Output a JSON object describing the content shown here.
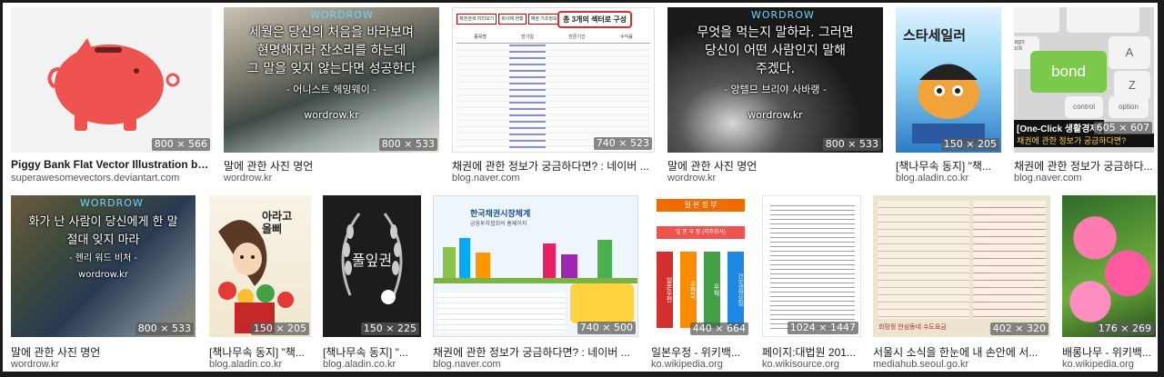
{
  "results": [
    {
      "title": "Piggy Bank Flat Vector Illustration by sup...",
      "domain": "superawesomevectors.deviantart.com",
      "dims": "800 × 566",
      "bold": true
    },
    {
      "title": "말에 관한 사진 명언",
      "domain": "wordrow.kr",
      "dims": "800 × 533",
      "bold": false,
      "overlay": [
        "세월은 당신의 처음을 바라보며",
        "현명해지라 잔소리를 하는데",
        "그 말을 잊지 않는다면 성공한다"
      ],
      "author": "- 어니스트 헤밍웨이 -",
      "brand": "wordrow.kr",
      "badge": "WORDROW"
    },
    {
      "title": "채권에 관한 정보가 궁금하다면? : 네이버 ...",
      "domain": "blog.naver.com",
      "dims": "740 × 523",
      "bold": false,
      "callout": "총 3개의 섹터로 구성",
      "tabs": [
        "채권검색 미리보기",
        "회사채 현황",
        "채권 기초정보 및 투자"
      ],
      "columns": [
        "종목명",
        "만기일",
        "잔존기간",
        "수익률"
      ]
    },
    {
      "title": "말에 관한 사진 명언",
      "domain": "wordrow.kr",
      "dims": "800 × 533",
      "bold": false,
      "overlay": [
        "무엇을 먹는지 말하라. 그러면",
        "당신이 어떤 사람인지 말해",
        "주겠다."
      ],
      "author": "- 앙텔므 브리야 사바랭 -",
      "brand": "wordrow.kr",
      "badge": "WORDROW"
    },
    {
      "title": "[책나무속 동지] \"책...",
      "domain": "blog.aladin.co.kr",
      "dims": "150 × 205",
      "bold": false,
      "cover_title": "스타세일러"
    },
    {
      "title": "채권에 관한 정보가 궁금하다...",
      "domain": "blog.naver.com",
      "dims": "605 × 607",
      "bold": false,
      "keys": [
        "bond",
        "caps lock",
        "control",
        "option",
        "A",
        "Z"
      ],
      "caption": "[One-Click 생활경제]",
      "caption2": "채권에 관한 정보가 궁금하다면?"
    },
    {
      "title": "말에 관한 사진 명언",
      "domain": "wordrow.kr",
      "dims": "800 × 533",
      "bold": false,
      "overlay": [
        "화가 난 사람이 당신에게 한 말",
        "절대 잊지 마라"
      ],
      "author": "- 헨리 워드 비처 -",
      "brand": "wordrow.kr",
      "badge": "WORDROW"
    },
    {
      "title": "[책나무속 동지] \"책...",
      "domain": "blog.aladin.co.kr",
      "dims": "150 × 205",
      "bold": false,
      "cover_title": "아라고 올삐"
    },
    {
      "title": "[책나무속 동지] \"...",
      "domain": "blog.aladin.co.kr",
      "dims": "150 × 225",
      "bold": false,
      "cover_title": "풀잎권"
    },
    {
      "title": "채권에 관한 정보가 궁금하다면? : 네이버 ...",
      "domain": "blog.naver.com",
      "dims": "740 × 500",
      "bold": false,
      "site_title": "한국채권시장체계",
      "site_sub": "금융투자협회의 홈페이지"
    },
    {
      "title": "일본우정 - 위키백...",
      "domain": "ko.wikipedia.org",
      "dims": "440 × 664",
      "bold": false,
      "header": "일 본 정 부",
      "row2": "일 본 우 정 (지주회사)",
      "cols": [
        "일본우편",
        "우편국",
        "우체",
        "간보생명보험"
      ]
    },
    {
      "title": "페이지:대법원 201...",
      "domain": "ko.wikisource.org",
      "dims": "1024 × 1447",
      "bold": false
    },
    {
      "title": "서울시 소식을 한눈에 내 손안에 서...",
      "domain": "mediahub.seoul.go.kr",
      "dims": "402 × 320",
      "bold": false,
      "stamp": "희망정 안심동네 수도요금"
    },
    {
      "title": "배롱나무 - 위키백...",
      "domain": "ko.wikipedia.org",
      "dims": "176 × 269",
      "bold": false
    }
  ]
}
